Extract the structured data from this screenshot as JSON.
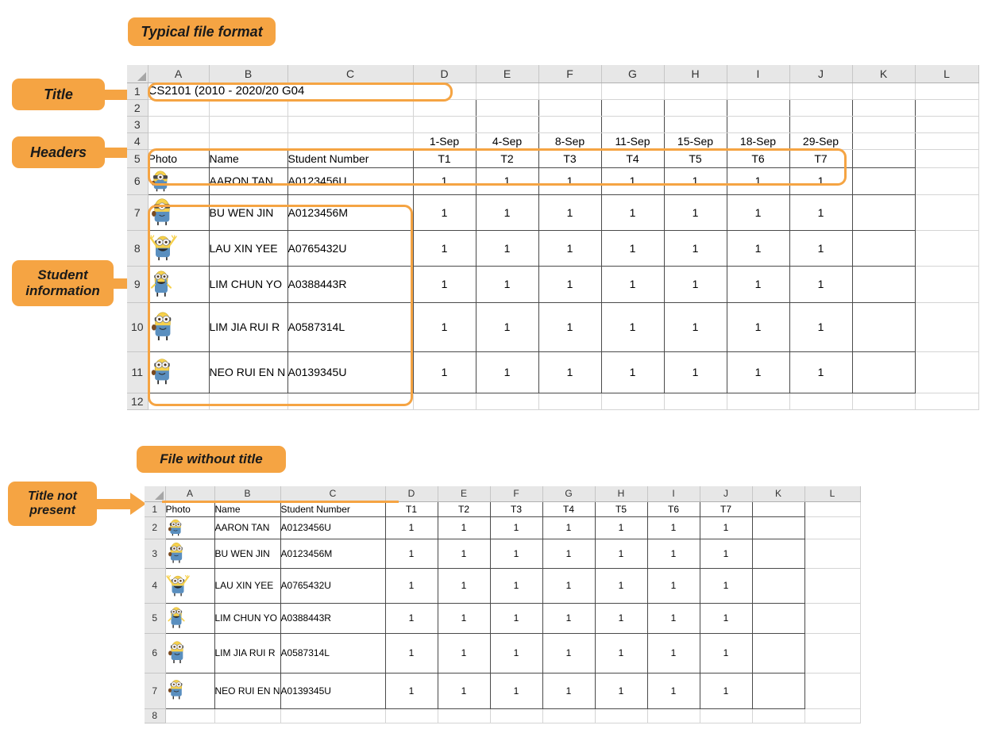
{
  "callouts": {
    "typical_file_format": "Typical file format",
    "title": "Title",
    "headers": "Headers",
    "student_information": "Student information",
    "student_information_l1": "Student",
    "student_information_l2": "information",
    "file_without_title": "File without title",
    "title_not_present_l1": "Title not",
    "title_not_present_l2": "present"
  },
  "colors": {
    "accent": "#F5A443",
    "header_gray": "#E7E7E7",
    "grid": "#D4D4D4",
    "border_dark": "#4A4A4A"
  },
  "sheet_top": {
    "column_letters": [
      "A",
      "B",
      "C",
      "D",
      "E",
      "F",
      "G",
      "H",
      "I",
      "J",
      "K",
      "L"
    ],
    "row_numbers": [
      "1",
      "2",
      "3",
      "4",
      "5",
      "6",
      "7",
      "8",
      "9",
      "10",
      "11",
      "12"
    ],
    "title_cell": "CS2101 (2010 - 2020/20 G04",
    "date_header_row": [
      "",
      "",
      "",
      "1-Sep",
      "4-Sep",
      "8-Sep",
      "11-Sep",
      "15-Sep",
      "18-Sep",
      "29-Sep",
      "",
      ""
    ],
    "column_header_row": [
      "Photo",
      "Name",
      "Student Number",
      "T1",
      "T2",
      "T3",
      "T4",
      "T5",
      "T6",
      "T7",
      "",
      ""
    ],
    "students": [
      {
        "photo": "minion-hand-left",
        "name": "AARON TAN",
        "number": "A0123456U",
        "marks": [
          "1",
          "1",
          "1",
          "1",
          "1",
          "1",
          "1"
        ]
      },
      {
        "photo": "minion-hand-left",
        "name": "BU WEN JIN",
        "number": "A0123456M",
        "marks": [
          "1",
          "1",
          "1",
          "1",
          "1",
          "1",
          "1"
        ]
      },
      {
        "photo": "minion-arms-up",
        "name": "LAU XIN YEE",
        "number": "A0765432U",
        "marks": [
          "1",
          "1",
          "1",
          "1",
          "1",
          "1",
          "1"
        ]
      },
      {
        "photo": "minion-overalls",
        "name": "LIM CHUN YO",
        "number": "A0388443R",
        "marks": [
          "1",
          "1",
          "1",
          "1",
          "1",
          "1",
          "1"
        ]
      },
      {
        "photo": "minion-hand-left",
        "name": "LIM JIA RUI R",
        "number": "A0587314L",
        "marks": [
          "1",
          "1",
          "1",
          "1",
          "1",
          "1",
          "1"
        ]
      },
      {
        "photo": "minion-hand-left",
        "name": "NEO RUI EN N",
        "number": "A0139345U",
        "marks": [
          "1",
          "1",
          "1",
          "1",
          "1",
          "1",
          "1"
        ]
      }
    ]
  },
  "sheet_bottom": {
    "column_letters": [
      "A",
      "B",
      "C",
      "D",
      "E",
      "F",
      "G",
      "H",
      "I",
      "J",
      "K",
      "L"
    ],
    "row_numbers": [
      "1",
      "2",
      "3",
      "4",
      "5",
      "6",
      "7",
      "8"
    ],
    "column_header_row": [
      "Photo",
      "Name",
      "Student Number",
      "T1",
      "T2",
      "T3",
      "T4",
      "T5",
      "T6",
      "T7",
      "",
      ""
    ],
    "students": [
      {
        "photo": "minion-hand-left",
        "name": "AARON TAN",
        "number": "A0123456U",
        "marks": [
          "1",
          "1",
          "1",
          "1",
          "1",
          "1",
          "1"
        ]
      },
      {
        "photo": "minion-hand-left",
        "name": "BU WEN JIN",
        "number": "A0123456M",
        "marks": [
          "1",
          "1",
          "1",
          "1",
          "1",
          "1",
          "1"
        ]
      },
      {
        "photo": "minion-arms-up",
        "name": "LAU XIN YEE",
        "number": "A0765432U",
        "marks": [
          "1",
          "1",
          "1",
          "1",
          "1",
          "1",
          "1"
        ]
      },
      {
        "photo": "minion-overalls",
        "name": "LIM CHUN YO",
        "number": "A0388443R",
        "marks": [
          "1",
          "1",
          "1",
          "1",
          "1",
          "1",
          "1"
        ]
      },
      {
        "photo": "minion-hand-left",
        "name": "LIM JIA RUI R",
        "number": "A0587314L",
        "marks": [
          "1",
          "1",
          "1",
          "1",
          "1",
          "1",
          "1"
        ]
      },
      {
        "photo": "minion-hand-left",
        "name": "NEO RUI EN N",
        "number": "A0139345U",
        "marks": [
          "1",
          "1",
          "1",
          "1",
          "1",
          "1",
          "1"
        ]
      }
    ]
  }
}
